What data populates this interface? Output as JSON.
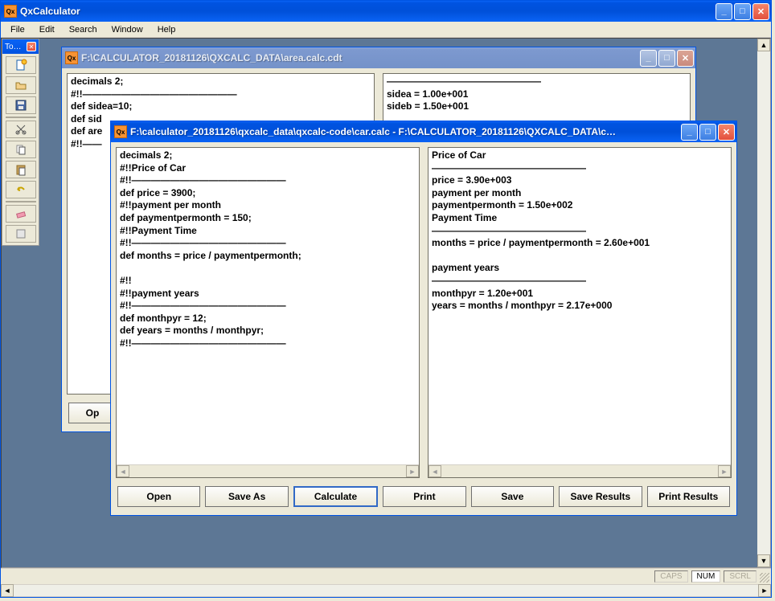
{
  "app": {
    "title": "QxCalculator"
  },
  "menu": {
    "file": "File",
    "edit": "Edit",
    "search": "Search",
    "window": "Window",
    "help": "Help"
  },
  "toolbox": {
    "title": "To…"
  },
  "status": {
    "caps": "CAPS",
    "num": "NUM",
    "scrl": "SCRL"
  },
  "doc1": {
    "title": "F:\\CALCULATOR_20181126\\QXCALC_DATA\\area.calc.cdt",
    "left": "decimals 2;\n#!!————————————————\ndef sidea=10;\ndef sid\ndef are\n#!!——",
    "right": "————————————————\nsidea = 1.00e+001\nsideb = 1.50e+001",
    "buttons": {
      "open_partial": "Op"
    }
  },
  "doc2": {
    "title": "F:\\calculator_20181126\\qxcalc_data\\qxcalc-code\\car.calc - F:\\CALCULATOR_20181126\\QXCALC_DATA\\c…",
    "left": "decimals 2;\n#!!Price of Car\n#!!————————————————\ndef price = 3900;\n#!!payment per month\ndef paymentpermonth = 150;\n#!!Payment Time\n#!!————————————————\ndef months = price / paymentpermonth;\n\n#!!\n#!!payment years\n#!!————————————————\ndef monthpyr = 12;\ndef years = months / monthpyr;\n#!!————————————————",
    "right": "Price of Car\n————————————————\nprice = 3.90e+003\npayment per month\npaymentpermonth = 1.50e+002\nPayment Time\n————————————————\nmonths = price / paymentpermonth = 2.60e+001\n\npayment years\n————————————————\nmonthpyr = 1.20e+001\nyears = months / monthpyr = 2.17e+000",
    "buttons": {
      "open": "Open",
      "save_as": "Save As",
      "calculate": "Calculate",
      "print": "Print",
      "save": "Save",
      "save_results": "Save Results",
      "print_results": "Print Results"
    }
  }
}
